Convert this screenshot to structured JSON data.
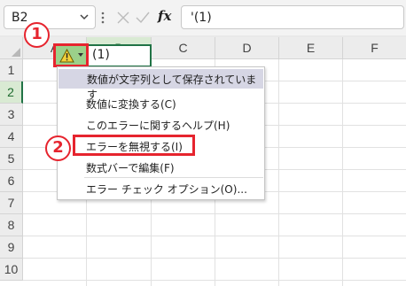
{
  "formula_bar": {
    "name_box": "B2",
    "fx_label": "fx",
    "formula": "'(1)"
  },
  "grid": {
    "columns": [
      "A",
      "B",
      "C",
      "D",
      "E",
      "F"
    ],
    "rows": [
      "1",
      "2",
      "3",
      "4",
      "5",
      "6",
      "7",
      "8",
      "9",
      "10"
    ],
    "selected_cell": "B2",
    "cell_b2_value": "(1)"
  },
  "annotations": {
    "step1": "1",
    "step2": "2",
    "color": "#e6242e"
  },
  "error_menu": {
    "header": "数値が文字列として保存されています",
    "items": [
      "数値に変換する(C)",
      "このエラーに関するヘルプ(H)",
      "エラーを無視する(I)",
      "数式バーで編集(F)",
      "エラー チェック オプション(O)..."
    ]
  },
  "colors": {
    "accent_green": "#217346",
    "error_button_bg": "#9bd08a",
    "menu_header_bg": "#d6d6e4"
  },
  "icons": [
    "chevron-down-icon",
    "more-dots-icon",
    "cancel-x-icon",
    "enter-check-icon",
    "warning-icon"
  ]
}
